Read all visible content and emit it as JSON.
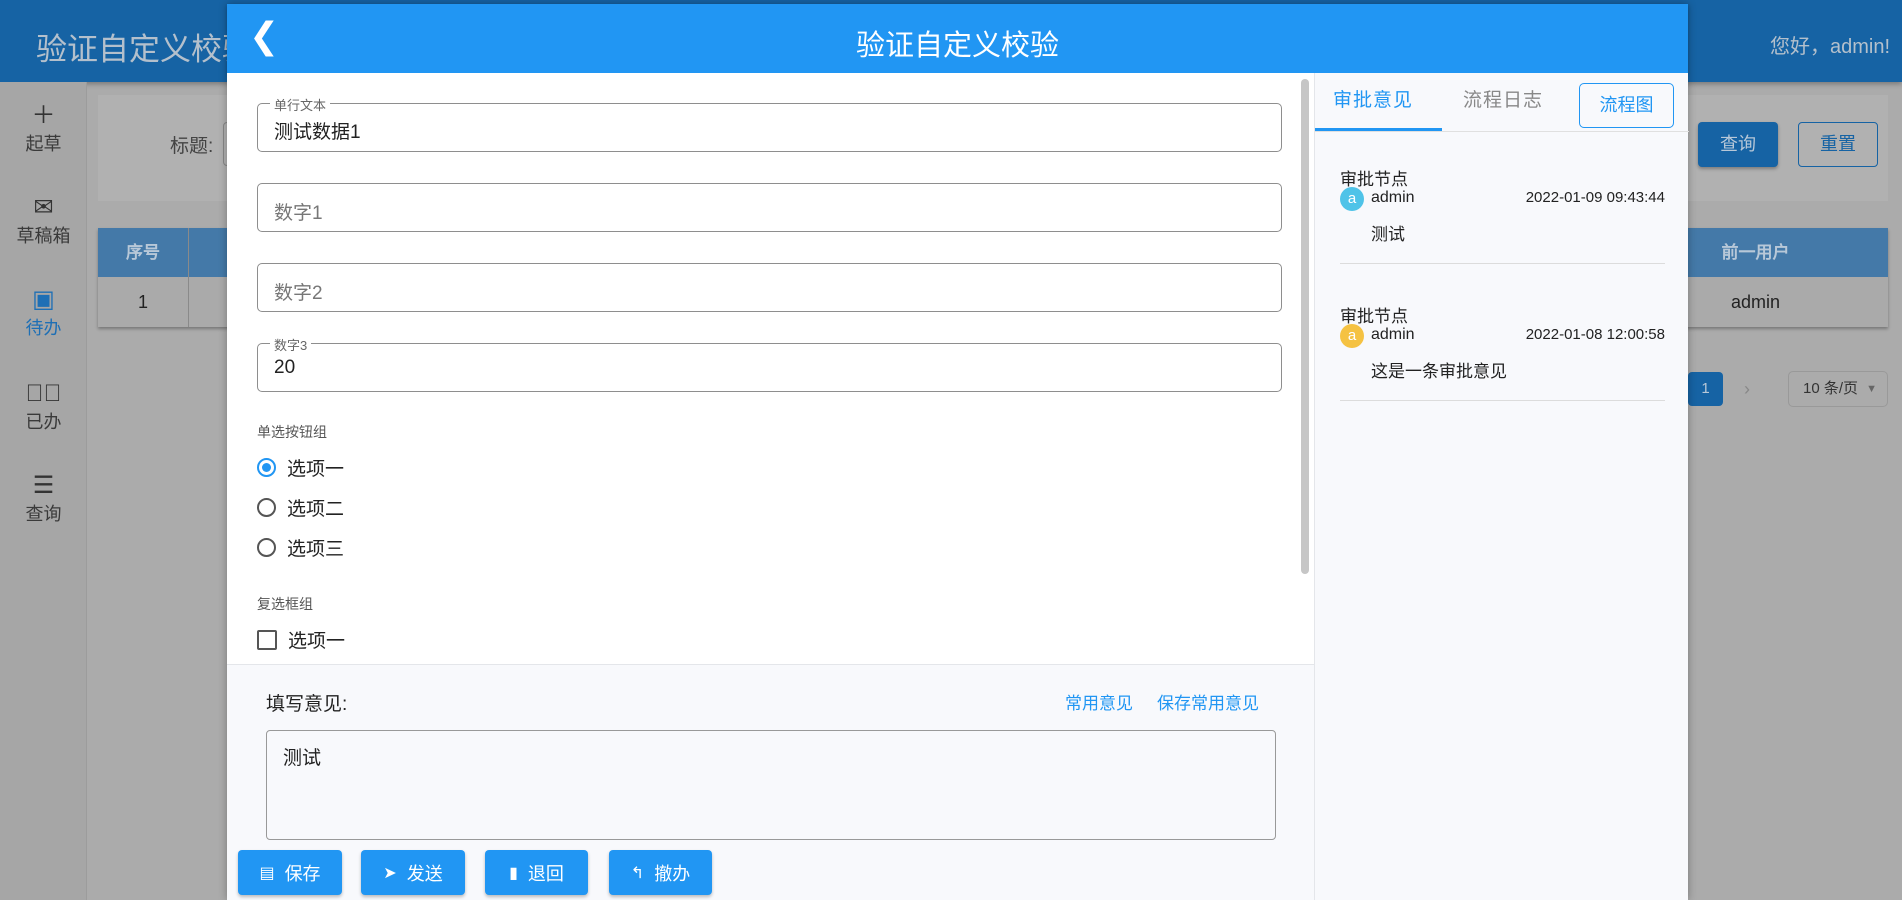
{
  "app": {
    "title": "验证自定义校验",
    "greeting": "您好，admin!"
  },
  "sidebar": {
    "items": [
      {
        "label": "起草",
        "icon": "plus-icon"
      },
      {
        "label": "草稿箱",
        "icon": "envelope-open-icon"
      },
      {
        "label": "待办",
        "icon": "inbox-icon",
        "active": true
      },
      {
        "label": "已办",
        "icon": "check-circle-icon"
      },
      {
        "label": "查询",
        "icon": "list-icon"
      }
    ]
  },
  "search": {
    "title_label": "标题:",
    "query": "查询",
    "reset": "重置"
  },
  "table": {
    "headers": [
      "序号",
      "前一用户"
    ],
    "rows": [
      [
        "1",
        "admin"
      ]
    ]
  },
  "pagination": {
    "current": "1",
    "next": "›",
    "page_size": "10 条/页"
  },
  "modal": {
    "title": "验证自定义校验",
    "fields": [
      {
        "label": "单行文本",
        "value": "测试数据1"
      },
      {
        "placeholder": "数字1"
      },
      {
        "placeholder": "数字2"
      },
      {
        "label": "数字3",
        "value": "20"
      }
    ],
    "radio_group": {
      "label": "单选按钮组",
      "options": [
        "选项一",
        "选项二",
        "选项三"
      ],
      "selected": "选项一"
    },
    "checkbox_group": {
      "label": "复选框组",
      "options": [
        "选项一"
      ]
    },
    "opinion": {
      "label": "填写意见:",
      "common": "常用意见",
      "save_common": "保存常用意见",
      "value": "测试"
    },
    "buttons": {
      "save": "保存",
      "send": "发送",
      "return": "退回",
      "withdraw": "撤办"
    },
    "right": {
      "tabs": [
        "审批意见",
        "流程日志"
      ],
      "flow_chart": "流程图",
      "entries": [
        {
          "node": "审批节点",
          "avatar": "a",
          "avatar_color": "#4fc3e8",
          "user": "admin",
          "time": "2022-01-09 09:43:44",
          "message": "测试"
        },
        {
          "node": "审批节点",
          "avatar": "a",
          "avatar_color": "#f5c242",
          "user": "admin",
          "time": "2022-01-08 12:00:58",
          "message": "这是一条审批意见"
        }
      ]
    }
  },
  "colors": {
    "primary": "#2196f3",
    "header_dim": "#1663a4"
  }
}
